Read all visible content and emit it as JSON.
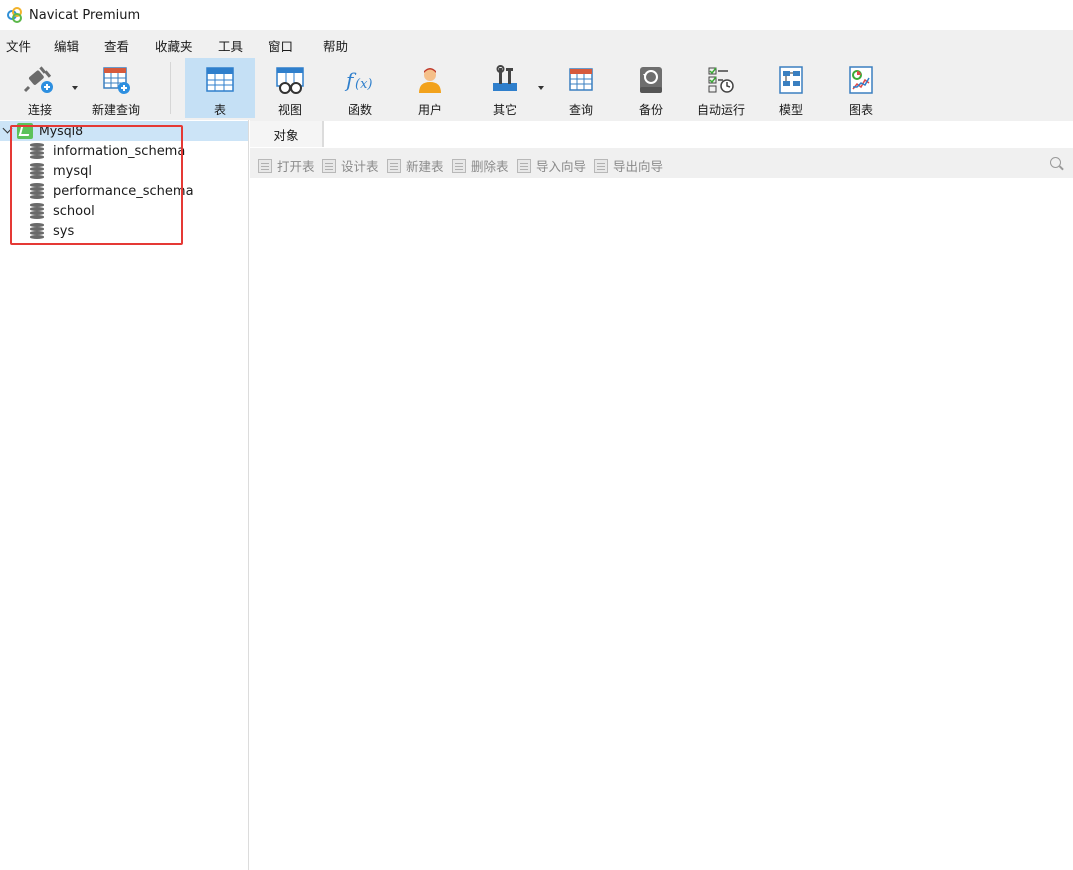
{
  "window": {
    "title": "Navicat Premium"
  },
  "menu": [
    "文件",
    "编辑",
    "查看",
    "收藏夹",
    "工具",
    "窗口",
    "帮助"
  ],
  "toolbar": {
    "connect": "连接",
    "new_query": "新建查询",
    "table": "表",
    "view": "视图",
    "function": "函数",
    "user": "用户",
    "other": "其它",
    "query": "查询",
    "backup": "备份",
    "automation": "自动运行",
    "model": "模型",
    "chart": "图表"
  },
  "navigator": {
    "connection": "Mysql8",
    "databases": [
      "information_schema",
      "mysql",
      "performance_schema",
      "school",
      "sys"
    ]
  },
  "main": {
    "tab": "对象",
    "actions": [
      "打开表",
      "设计表",
      "新建表",
      "删除表",
      "导入向导",
      "导出向导"
    ]
  },
  "colors": {
    "accent": "#c5e0f5",
    "highlight": "#e53935",
    "connection": "#5cc25a"
  }
}
